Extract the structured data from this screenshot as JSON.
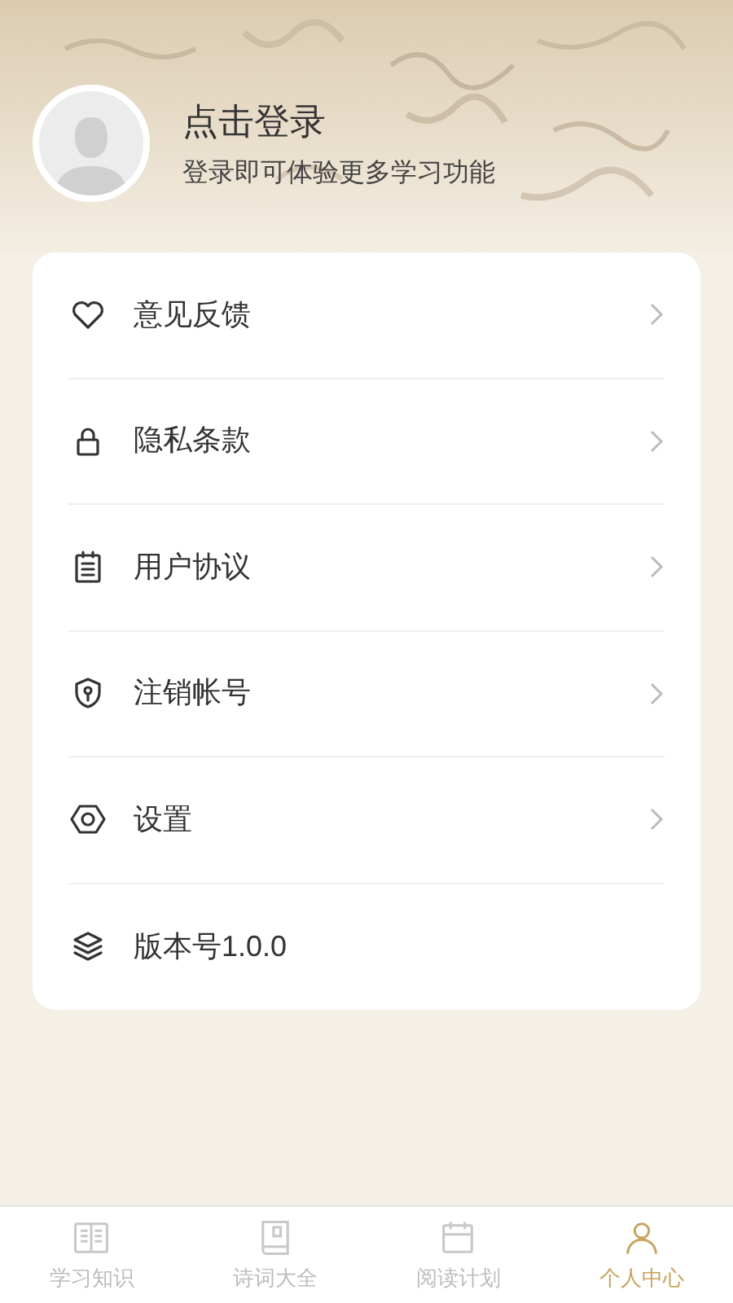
{
  "profile": {
    "title": "点击登录",
    "subtitle": "登录即可体验更多学习功能"
  },
  "menu": [
    {
      "label": "意见反馈",
      "kind": "link"
    },
    {
      "label": "隐私条款",
      "kind": "link"
    },
    {
      "label": "用户协议",
      "kind": "link"
    },
    {
      "label": "注销帐号",
      "kind": "link"
    },
    {
      "label": "设置",
      "kind": "link"
    },
    {
      "label": "版本号1.0.0",
      "kind": "info"
    }
  ],
  "tabs": [
    {
      "label": "学习知识",
      "selected": false
    },
    {
      "label": "诗词大全",
      "selected": false
    },
    {
      "label": "阅读计划",
      "selected": false
    },
    {
      "label": "个人中心",
      "selected": true
    }
  ]
}
